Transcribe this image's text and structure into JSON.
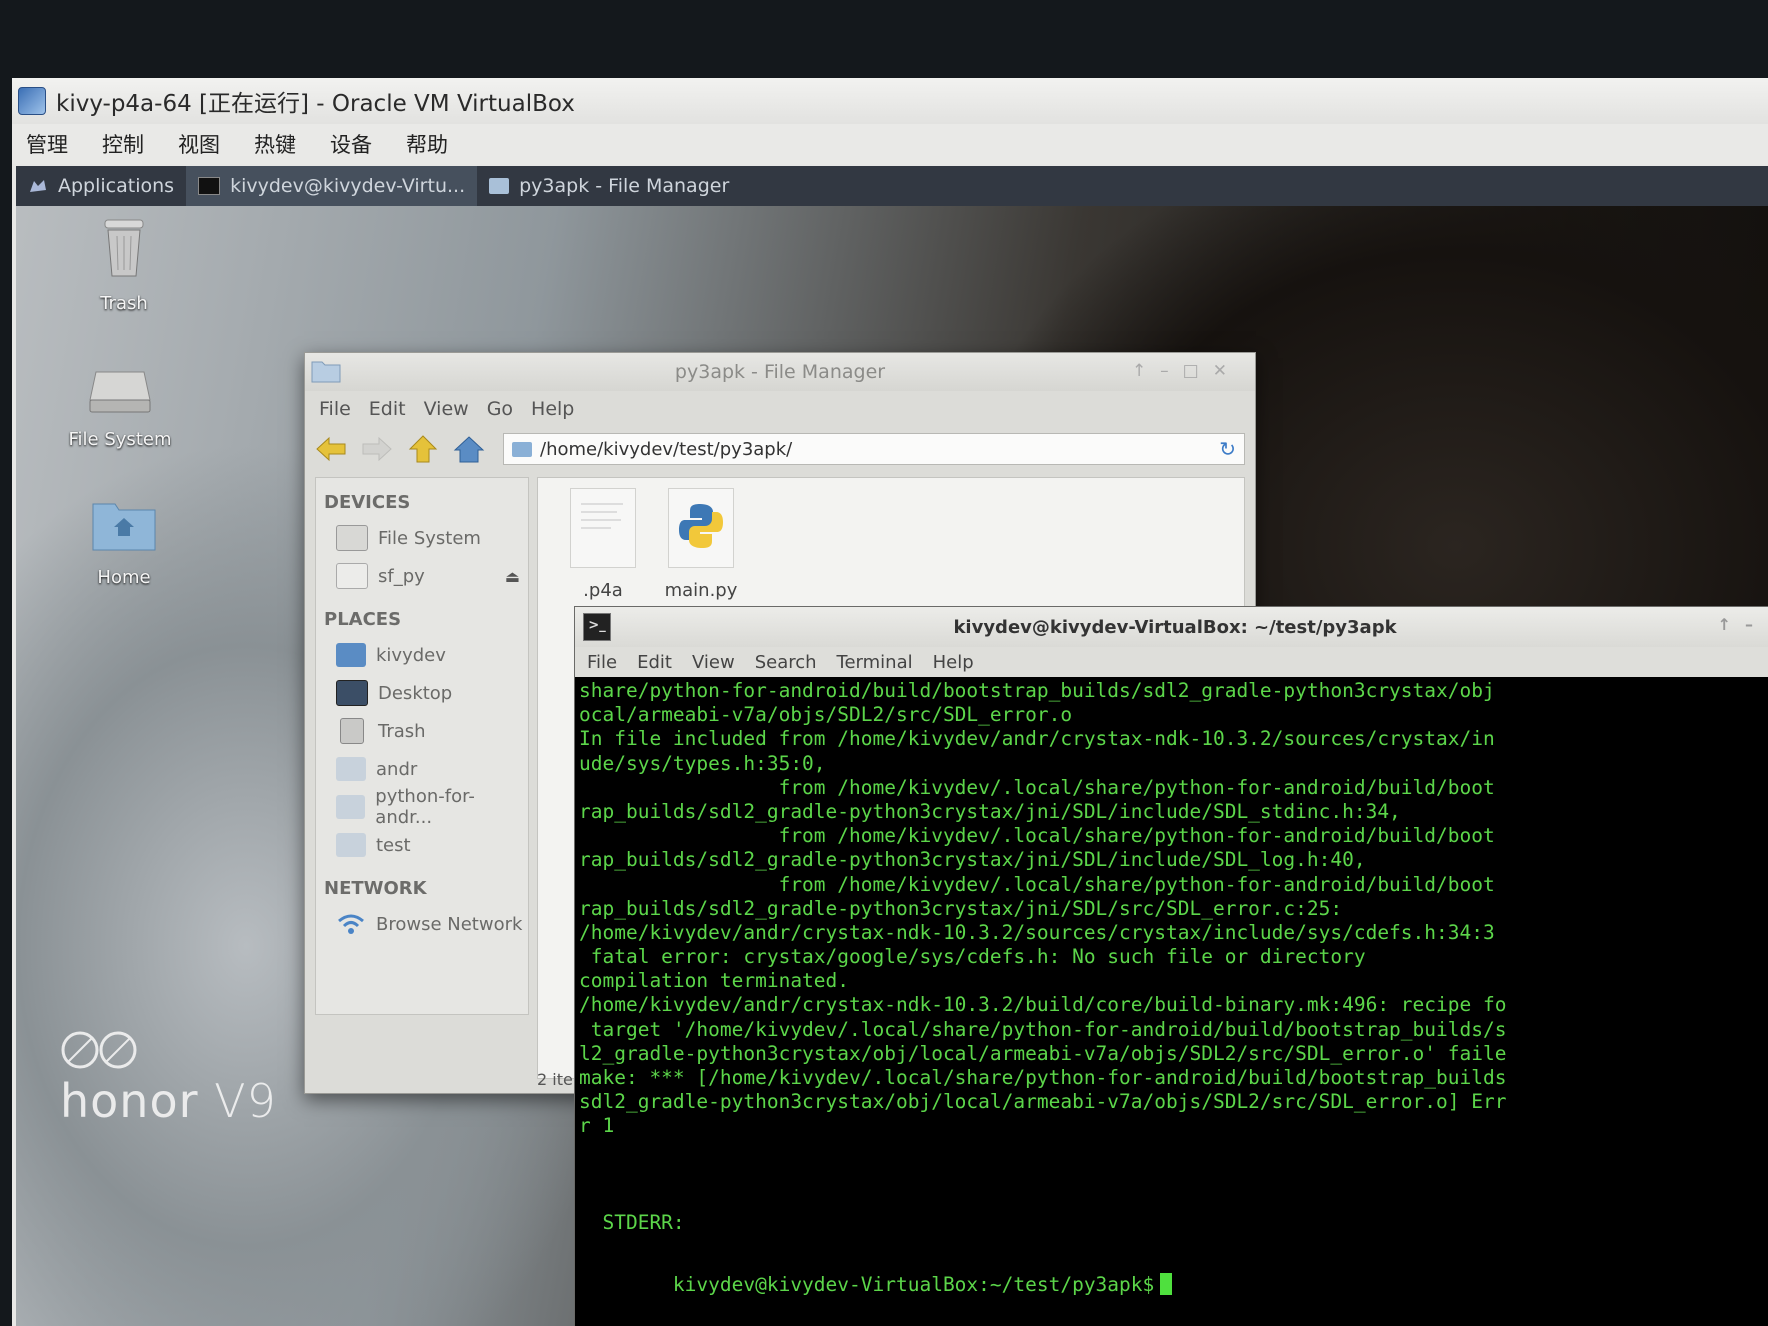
{
  "host_window": {
    "title": "kivy-p4a-64 [正在运行] - Oracle VM VirtualBox",
    "menu": [
      "管理",
      "控制",
      "视图",
      "热键",
      "设备",
      "帮助"
    ]
  },
  "panel": {
    "applications_label": "Applications",
    "tasks": [
      {
        "label": "kivydev@kivydev-Virtu...",
        "icon": "terminal-icon"
      },
      {
        "label": "py3apk - File Manager",
        "icon": "folder-icon"
      }
    ]
  },
  "desktop": {
    "icons": [
      {
        "label": "Trash",
        "icon": "trash-icon"
      },
      {
        "label": "File System",
        "icon": "drive-icon"
      },
      {
        "label": "Home",
        "icon": "home-folder-icon"
      }
    ]
  },
  "file_manager": {
    "title": "py3apk - File Manager",
    "menu": [
      "File",
      "Edit",
      "View",
      "Go",
      "Help"
    ],
    "path": "/home/kivydev/test/py3apk/",
    "sections": {
      "devices": {
        "header": "DEVICES",
        "items": [
          {
            "label": "File System",
            "icon": "drive-icon"
          },
          {
            "label": "sf_py",
            "icon": "drive-icon"
          }
        ]
      },
      "places": {
        "header": "PLACES",
        "items": [
          {
            "label": "kivydev",
            "icon": "home-icon"
          },
          {
            "label": "Desktop",
            "icon": "desktop-icon"
          },
          {
            "label": "Trash",
            "icon": "trash-icon"
          },
          {
            "label": "andr",
            "icon": "folder-icon"
          },
          {
            "label": "python-for-andr...",
            "icon": "folder-icon"
          },
          {
            "label": "test",
            "icon": "folder-icon"
          }
        ]
      },
      "network": {
        "header": "NETWORK",
        "items": [
          {
            "label": "Browse Network",
            "icon": "network-icon"
          }
        ]
      }
    },
    "files": [
      {
        "name": ".p4a",
        "icon": "text-file-icon"
      },
      {
        "name": "main.py",
        "icon": "python-file-icon"
      }
    ],
    "status": "2 ite"
  },
  "terminal": {
    "title": "kivydev@kivydev-VirtualBox: ~/test/py3apk",
    "menu": [
      "File",
      "Edit",
      "View",
      "Search",
      "Terminal",
      "Help"
    ],
    "lines": [
      "share/python-for-android/build/bootstrap_builds/sdl2_gradle-python3crystax/obj",
      "ocal/armeabi-v7a/objs/SDL2/src/SDL_error.o",
      "In file included from /home/kivydev/andr/crystax-ndk-10.3.2/sources/crystax/in",
      "ude/sys/types.h:35:0,",
      "                 from /home/kivydev/.local/share/python-for-android/build/boot",
      "rap_builds/sdl2_gradle-python3crystax/jni/SDL/include/SDL_stdinc.h:34,",
      "                 from /home/kivydev/.local/share/python-for-android/build/boot",
      "rap_builds/sdl2_gradle-python3crystax/jni/SDL/include/SDL_log.h:40,",
      "                 from /home/kivydev/.local/share/python-for-android/build/boot",
      "rap_builds/sdl2_gradle-python3crystax/jni/SDL/src/SDL_error.c:25:",
      "/home/kivydev/andr/crystax-ndk-10.3.2/sources/crystax/include/sys/cdefs.h:34:3",
      " fatal error: crystax/google/sys/cdefs.h: No such file or directory",
      "compilation terminated.",
      "/home/kivydev/andr/crystax-ndk-10.3.2/build/core/build-binary.mk:496: recipe fo",
      " target '/home/kivydev/.local/share/python-for-android/build/bootstrap_builds/s",
      "l2_gradle-python3crystax/obj/local/armeabi-v7a/objs/SDL2/src/SDL_error.o' faile",
      "make: *** [/home/kivydev/.local/share/python-for-android/build/bootstrap_builds",
      "sdl2_gradle-python3crystax/obj/local/armeabi-v7a/objs/SDL2/src/SDL_error.o] Err",
      "r 1",
      "",
      "",
      "",
      "  STDERR:"
    ],
    "prompt": "kivydev@kivydev-VirtualBox:~/test/py3apk$"
  },
  "watermark": {
    "brand": "honor",
    "model": "V9"
  }
}
